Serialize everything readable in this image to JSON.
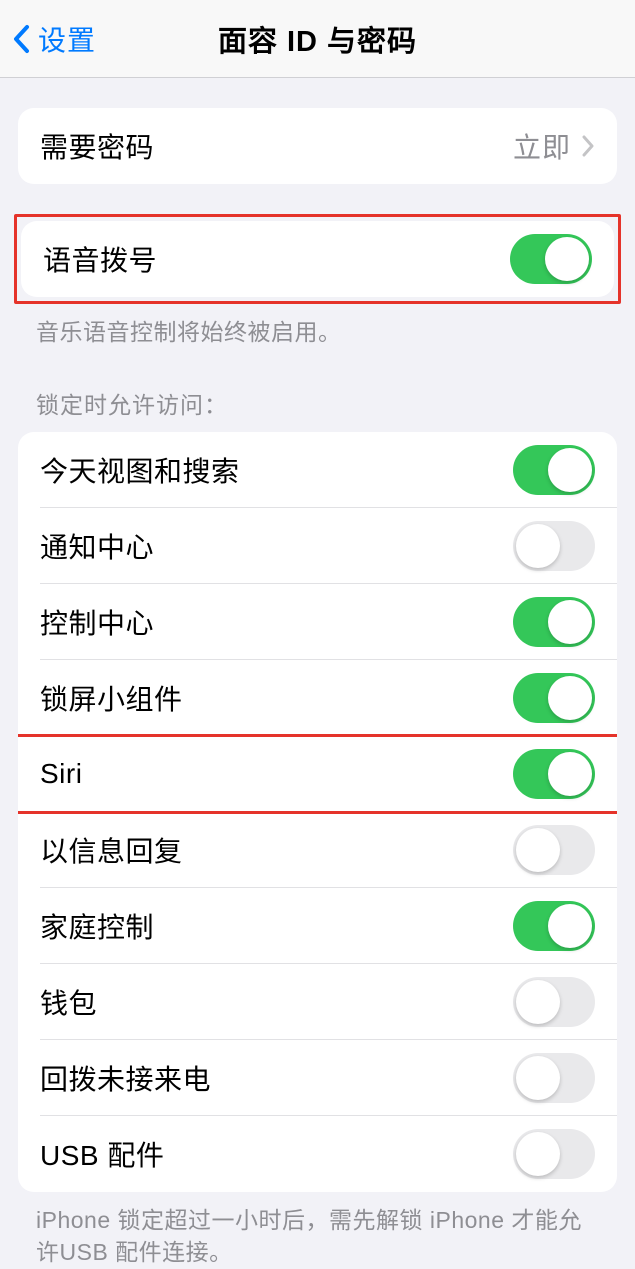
{
  "nav": {
    "back_label": "设置",
    "title": "面容 ID 与密码"
  },
  "require_passcode": {
    "label": "需要密码",
    "value": "立即"
  },
  "voice_dial": {
    "label": "语音拨号",
    "on": true,
    "footer": "音乐语音控制将始终被启用。"
  },
  "locked_access": {
    "header": "锁定时允许访问：",
    "items": [
      {
        "label": "今天视图和搜索",
        "on": true
      },
      {
        "label": "通知中心",
        "on": false
      },
      {
        "label": "控制中心",
        "on": true
      },
      {
        "label": "锁屏小组件",
        "on": true
      },
      {
        "label": "Siri",
        "on": true
      },
      {
        "label": "以信息回复",
        "on": false
      },
      {
        "label": "家庭控制",
        "on": true
      },
      {
        "label": "钱包",
        "on": false
      },
      {
        "label": "回拨未接来电",
        "on": false
      },
      {
        "label": "USB 配件",
        "on": false
      }
    ],
    "footer": "iPhone 锁定超过一小时后，需先解锁 iPhone 才能允许USB 配件连接。"
  }
}
